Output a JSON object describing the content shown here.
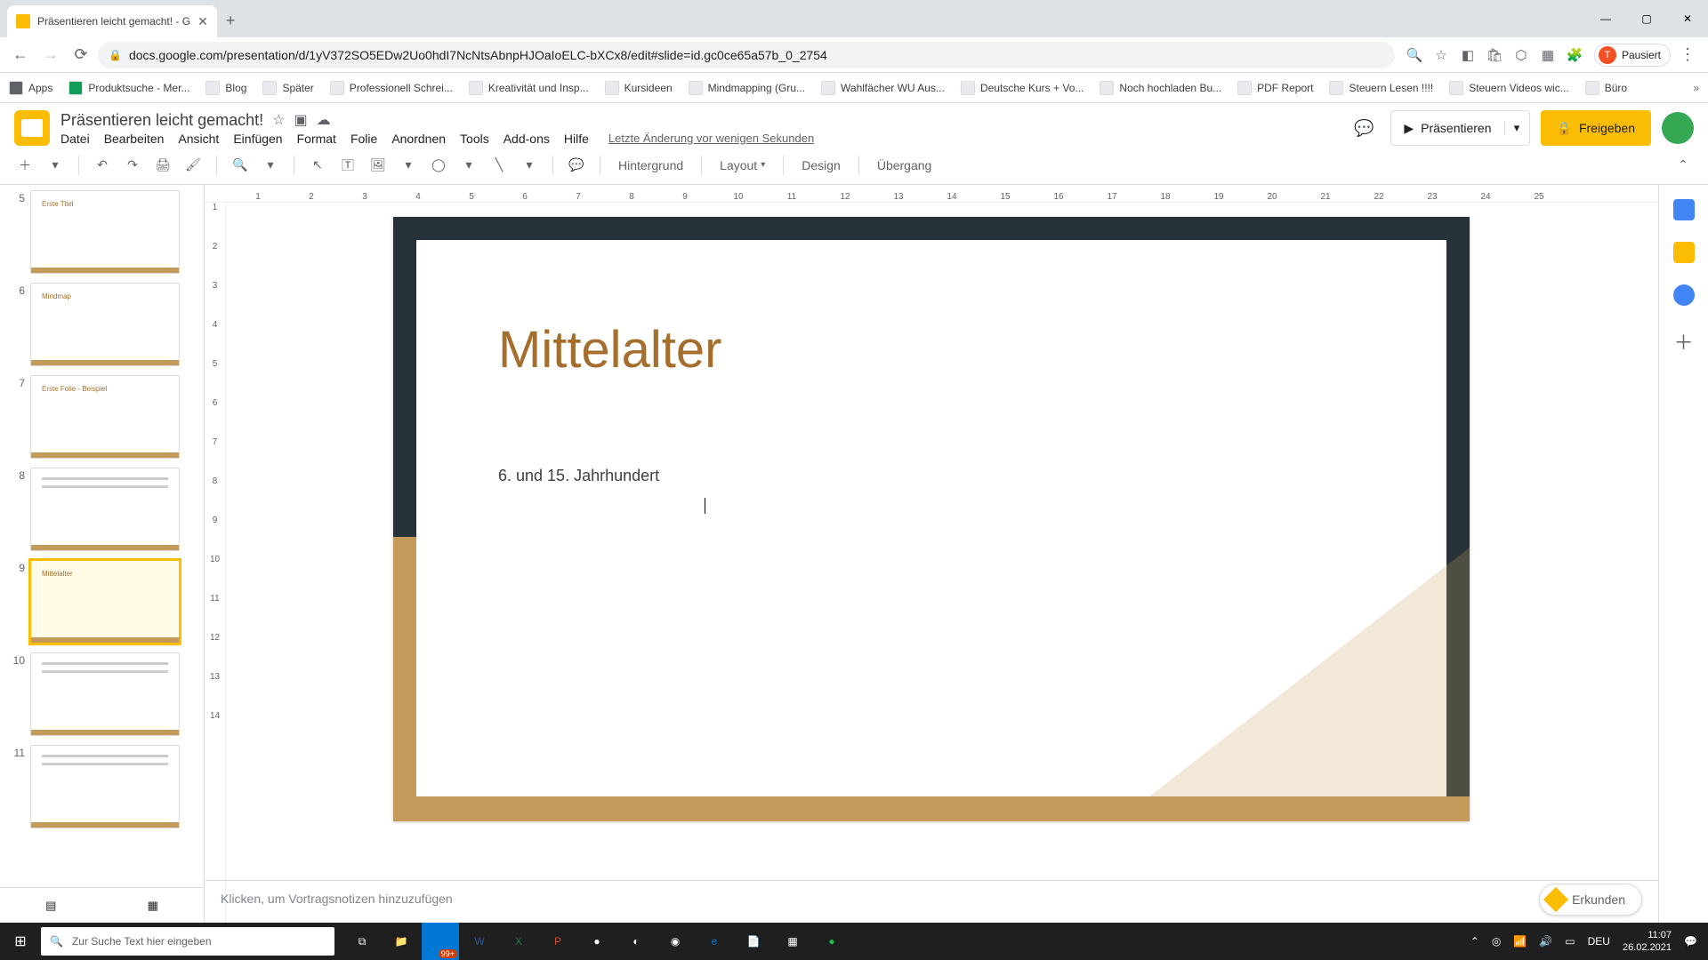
{
  "browser": {
    "tab_title": "Präsentieren leicht gemacht! - G",
    "url": "docs.google.com/presentation/d/1yV372SO5EDw2Uo0hdI7NcNtsAbnpHJOaIoELC-bXCx8/edit#slide=id.gc0ce65a57b_0_2754",
    "profile_label": "Pausiert",
    "profile_initial": "T"
  },
  "bookmarks": [
    "Apps",
    "Produktsuche - Mer...",
    "Blog",
    "Später",
    "Professionell Schrei...",
    "Kreativität und Insp...",
    "Kursideen",
    "Mindmapping (Gru...",
    "Wahlfächer WU Aus...",
    "Deutsche Kurs + Vo...",
    "Noch hochladen Bu...",
    "PDF Report",
    "Steuern Lesen !!!!",
    "Steuern Videos wic...",
    "Büro"
  ],
  "doc": {
    "title": "Präsentieren leicht gemacht!",
    "menu": [
      "Datei",
      "Bearbeiten",
      "Ansicht",
      "Einfügen",
      "Format",
      "Folie",
      "Anordnen",
      "Tools",
      "Add-ons",
      "Hilfe"
    ],
    "last_edit": "Letzte Änderung vor wenigen Sekunden",
    "present": "Präsentieren",
    "share": "Freigeben"
  },
  "toolbar": {
    "background": "Hintergrund",
    "layout": "Layout",
    "design": "Design",
    "transition": "Übergang"
  },
  "ruler_h": [
    "1",
    "2",
    "3",
    "4",
    "5",
    "6",
    "7",
    "8",
    "9",
    "10",
    "11",
    "12",
    "13",
    "14",
    "15",
    "16",
    "17",
    "18",
    "19",
    "20",
    "21",
    "22",
    "23",
    "24",
    "25"
  ],
  "ruler_v": [
    "1",
    "2",
    "3",
    "4",
    "5",
    "6",
    "7",
    "8",
    "9",
    "10",
    "11",
    "12",
    "13",
    "14"
  ],
  "filmstrip": [
    {
      "n": "5",
      "title": "Erste Titel"
    },
    {
      "n": "6",
      "title": "Mindmap"
    },
    {
      "n": "7",
      "title": "Erste Folie - Beispiel"
    },
    {
      "n": "8",
      "title": ""
    },
    {
      "n": "9",
      "title": "Mittelalter",
      "selected": true
    },
    {
      "n": "10",
      "title": ""
    },
    {
      "n": "11",
      "title": ""
    }
  ],
  "slide": {
    "title": "Mittelalter",
    "body": "6. und 15. Jahrhundert"
  },
  "notes_placeholder": "Klicken, um Vortragsnotizen hinzuzufügen",
  "explore": "Erkunden",
  "taskbar": {
    "search_placeholder": "Zur Suche Text hier eingeben",
    "lang": "DEU",
    "time": "11:07",
    "date": "26.02.2021",
    "notif_count": "99+"
  }
}
